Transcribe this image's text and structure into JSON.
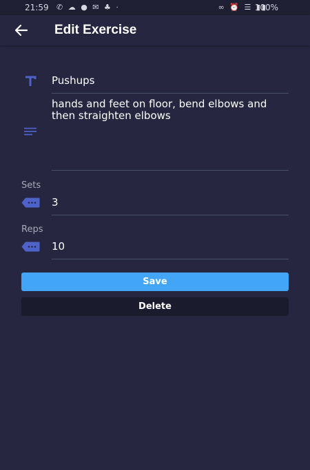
{
  "status_bar": {
    "time": "21:59",
    "battery": "100%"
  },
  "app_bar": {
    "title": "Edit Exercise",
    "back_icon": "arrow-left-icon"
  },
  "form": {
    "name": {
      "icon": "title-icon",
      "value": "Pushups"
    },
    "description": {
      "icon": "notes-icon",
      "value": "hands and feet on floor, bend elbows and then straighten elbows"
    },
    "sets": {
      "label": "Sets",
      "icon": "tag-icon",
      "value": "3"
    },
    "reps": {
      "label": "Reps",
      "icon": "tag-icon",
      "value": "10"
    }
  },
  "actions": {
    "save_label": "Save",
    "delete_label": "Delete"
  },
  "colors": {
    "background": "#262641",
    "accent": "#42a5f5",
    "icon": "#4e63c9",
    "delete_bg": "#1b1b2e"
  }
}
